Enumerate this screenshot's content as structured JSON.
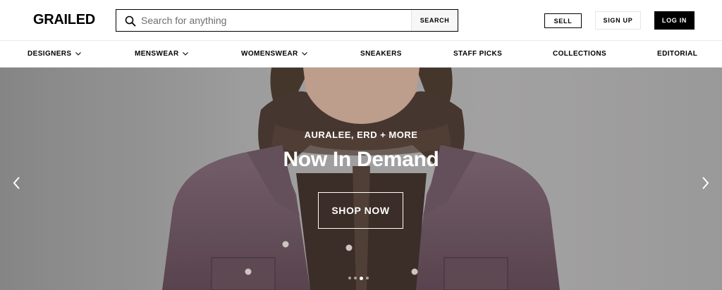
{
  "header": {
    "logo": "GRAILED",
    "search": {
      "placeholder": "Search for anything",
      "value": "",
      "button_label": "SEARCH",
      "icon": "search-icon"
    },
    "sell_label": "SELL",
    "signup_label": "SIGN UP",
    "login_label": "LOG IN"
  },
  "nav": {
    "items": [
      {
        "label": "DESIGNERS",
        "has_dropdown": true
      },
      {
        "label": "MENSWEAR",
        "has_dropdown": true
      },
      {
        "label": "WOMENSWEAR",
        "has_dropdown": true
      },
      {
        "label": "SNEAKERS",
        "has_dropdown": false
      },
      {
        "label": "STAFF PICKS",
        "has_dropdown": false
      },
      {
        "label": "COLLECTIONS",
        "has_dropdown": false
      },
      {
        "label": "EDITORIAL",
        "has_dropdown": false
      }
    ]
  },
  "hero": {
    "kicker": "AURALEE, ERD + MORE",
    "headline": "Now In Demand",
    "cta_label": "SHOP NOW",
    "slide_count": 4,
    "active_slide": 3,
    "prev_icon": "chevron-left-icon",
    "next_icon": "chevron-right-icon"
  },
  "colors": {
    "brand_black": "#000000",
    "hero_bg": "#a3a2a2",
    "jacket": "#6e5662",
    "text_on_hero": "#ffffff"
  }
}
